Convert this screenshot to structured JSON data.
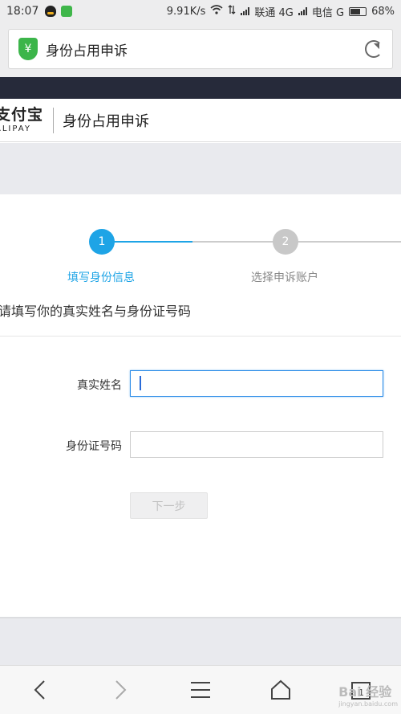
{
  "status_bar": {
    "time": "18:07",
    "speed": "9.91K/s",
    "carrier1": "联通 4G",
    "carrier2": "电信 G",
    "battery": "68%"
  },
  "address_bar": {
    "title": "身份占用申诉",
    "shield_glyph": "¥"
  },
  "header": {
    "logo_cn": "支付宝",
    "logo_en": "ALIPAY",
    "title": "身份占用申诉"
  },
  "steps": [
    {
      "number": "1",
      "label": "填写身份信息",
      "state": "active"
    },
    {
      "number": "2",
      "label": "选择申诉账户",
      "state": "inactive"
    }
  ],
  "instruction": "请填写你的真实姓名与身份证号码",
  "form": {
    "name_label": "真实姓名",
    "name_value": "",
    "id_label": "身份证号码",
    "id_value": "",
    "next_button": "下一步"
  },
  "colors": {
    "accent": "#1ea4e6",
    "shield": "#3cb54a",
    "dark_band": "#262a3a"
  },
  "watermark": {
    "main": "Bai 经验",
    "sub": "jingyan.baidu.com"
  }
}
